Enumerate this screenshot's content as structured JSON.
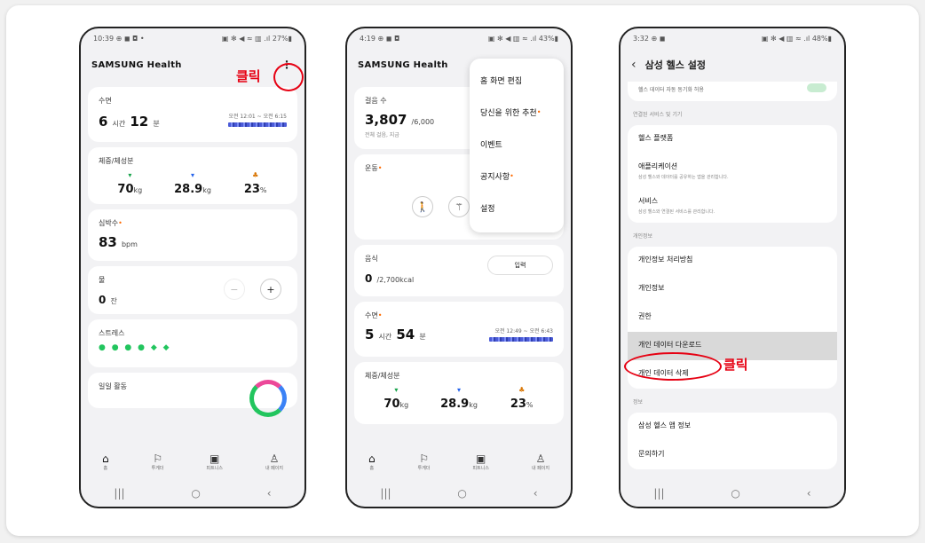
{
  "click_label": "클릭",
  "colors": {
    "accent": "#e60012",
    "orange_dot": "#ff6a00",
    "sleep_bar": "#4b5bd8"
  },
  "screen1": {
    "status_time": "10:39 ⊕ ◼ ◘ •",
    "status_icons": "▣ ✻ ◀ ≈ ▥ .ıl 27%▮",
    "brand": "SAMSUNG Health",
    "menu_icon": "⋮",
    "sleep": {
      "label": "수면",
      "hours": "6",
      "hours_unit": "시간",
      "minutes": "12",
      "minutes_unit": "분",
      "time": "오전 12:01 ~ 오전 6:15"
    },
    "body": {
      "label": "체중/체성분",
      "weight": "70",
      "weight_unit": "kg",
      "muscle": "28.9",
      "muscle_unit": "kg",
      "fat": "23",
      "fat_unit": "%"
    },
    "heart": {
      "label": "심박수",
      "value": "83",
      "unit": "bpm"
    },
    "water": {
      "label": "물",
      "value": "0",
      "unit": "잔",
      "minus": "−",
      "plus": "+"
    },
    "stress": {
      "label": "스트레스",
      "value": "● ● ● ● ◆ ◆"
    },
    "activity": {
      "label": "일일 활동"
    },
    "nav": [
      "홈",
      "투게더",
      "피트니스",
      "내 페이지"
    ],
    "sysnav": [
      "|||",
      "○",
      "‹"
    ]
  },
  "screen2": {
    "status_time": "4:19 ⊕ ◼ ◘",
    "status_icons": "▣ ✻ ◀ ▥ ≈ .ıl 43%▮",
    "brand": "SAMSUNG Health",
    "steps": {
      "label": "걸음 수",
      "value": "3,807",
      "goal": "/6,000",
      "sub": "전체 걸음, 지금"
    },
    "exercise": {
      "label": "운동"
    },
    "food": {
      "label": "음식",
      "value": "0",
      "goal": "/2,700kcal",
      "button": "입력"
    },
    "sleep": {
      "label": "수면",
      "hours": "5",
      "hours_unit": "시간",
      "minutes": "54",
      "minutes_unit": "분",
      "time": "오전 12:49 ~ 오전 6:43"
    },
    "body": {
      "label": "체중/체성분",
      "weight": "70",
      "weight_unit": "kg",
      "muscle": "28.9",
      "muscle_unit": "kg",
      "fat": "23",
      "fat_unit": "%"
    },
    "menu": [
      "홈 화면 편집",
      "당신을 위한 추천",
      "이벤트",
      "공지사항",
      "설정"
    ],
    "nav": [
      "홈",
      "투게더",
      "피트니스",
      "내 페이지"
    ],
    "sysnav": [
      "|||",
      "○",
      "‹"
    ]
  },
  "screen3": {
    "status_time": "3:32 ⊕ ◼",
    "status_icons": "▣ ✻ ◀ ▥ ≈ .ıl 48%▮",
    "title": "삼성 헬스 설정",
    "back": "‹",
    "top_row": "헬스 데이터 자동 동기화 허용",
    "section_connect": "연결된 서비스 및 기기",
    "connect_rows": [
      {
        "title": "헬스 플랫폼",
        "desc": ""
      },
      {
        "title": "애플리케이션",
        "desc": "삼성 헬스와 데이터를 공유하는 앱을 관리합니다."
      },
      {
        "title": "서비스",
        "desc": "삼성 헬스와 연결된 서비스를 관리합니다."
      }
    ],
    "section_personal": "개인정보",
    "personal_rows": [
      "개인정보 처리방침",
      "개인정보",
      "권한",
      "개인 데이터 다운로드",
      "개인 데이터 삭제"
    ],
    "section_info": "정보",
    "info_rows": [
      "삼성 헬스 앱 정보",
      "문의하기"
    ],
    "sysnav": [
      "|||",
      "○",
      "‹"
    ]
  }
}
